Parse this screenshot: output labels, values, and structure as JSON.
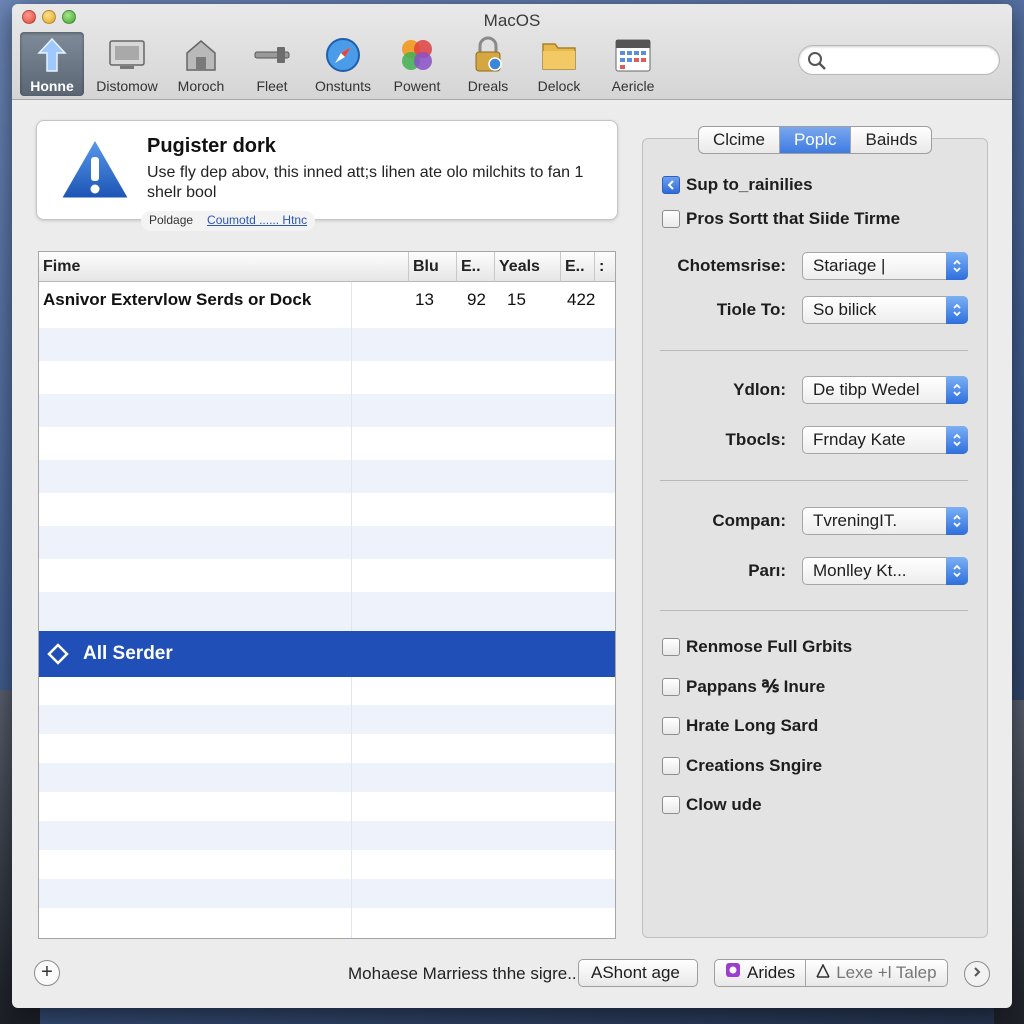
{
  "window": {
    "title": "MacOS"
  },
  "toolbar": {
    "items": [
      {
        "label": "Honne",
        "icon": "home-arrow-icon",
        "active": true
      },
      {
        "label": "Distomow",
        "icon": "display-icon"
      },
      {
        "label": "Moroch",
        "icon": "house-icon"
      },
      {
        "label": "Fleet",
        "icon": "hammer-icon"
      },
      {
        "label": "Onstunts",
        "icon": "compass-icon"
      },
      {
        "label": "Powent",
        "icon": "color-palette-icon"
      },
      {
        "label": "Dreals",
        "icon": "lock-icon"
      },
      {
        "label": "Delock",
        "icon": "folder-icon"
      },
      {
        "label": "Aericle",
        "icon": "calendar-icon"
      }
    ],
    "search_placeholder": ""
  },
  "alert": {
    "title": "Pugister dork",
    "body": "Use fly dep abov, this inned att;s lihen ate olo milchits to fan 1 shelr bool",
    "link_plain": "Poldage",
    "link_text": "Coumotd ...... Htnc"
  },
  "table": {
    "columns": [
      "Fime",
      "Blu",
      "E..",
      "Yeals",
      "E..",
      ":"
    ],
    "rows": [
      {
        "name": "Asnivor Extervlow Serds or Dock",
        "blu": "13",
        "e": "92",
        "yeals": "15",
        "e2": "422"
      }
    ],
    "selected_row": "All  Serder"
  },
  "panel": {
    "tabs": [
      {
        "label": "Clcime",
        "on": false
      },
      {
        "label": "Poplc",
        "on": true
      },
      {
        "label": "Baінds",
        "on": false
      }
    ],
    "checks_top": [
      {
        "label": "Sup to_rainilies",
        "checked": true
      },
      {
        "label": "Pros Sortt that Siide Tirme",
        "checked": false
      }
    ],
    "fields": [
      {
        "label": "Chotemsrise:",
        "value": "Stariage |"
      },
      {
        "label": "Tiole To:",
        "value": "So bilick"
      },
      {
        "label": "Ydlon:",
        "value": "De tibp Wedel"
      },
      {
        "label": "Tbocls:",
        "value": "Frnday Kate"
      },
      {
        "label": "Compan:",
        "value": "TvreningIT."
      },
      {
        "label": "Parı:",
        "value": "Monlley Kt..."
      }
    ],
    "checks_bottom": [
      {
        "label": "Renmose Full Grbits",
        "checked": false
      },
      {
        "label": "Pappans ℁ Inure",
        "checked": false
      },
      {
        "label": "Hrate Long Sard",
        "checked": false
      },
      {
        "label": "Creations Sngire",
        "checked": false
      },
      {
        "label": "Clow ude",
        "checked": false
      }
    ]
  },
  "bottom": {
    "status": "Mohaese Marriess thhe sigre..",
    "button1": "AShont age",
    "button2": "Arides",
    "button3": "Lexe +l Talep"
  },
  "colors": {
    "selection": "#1f4fb7",
    "accent": "#3e7be2"
  }
}
